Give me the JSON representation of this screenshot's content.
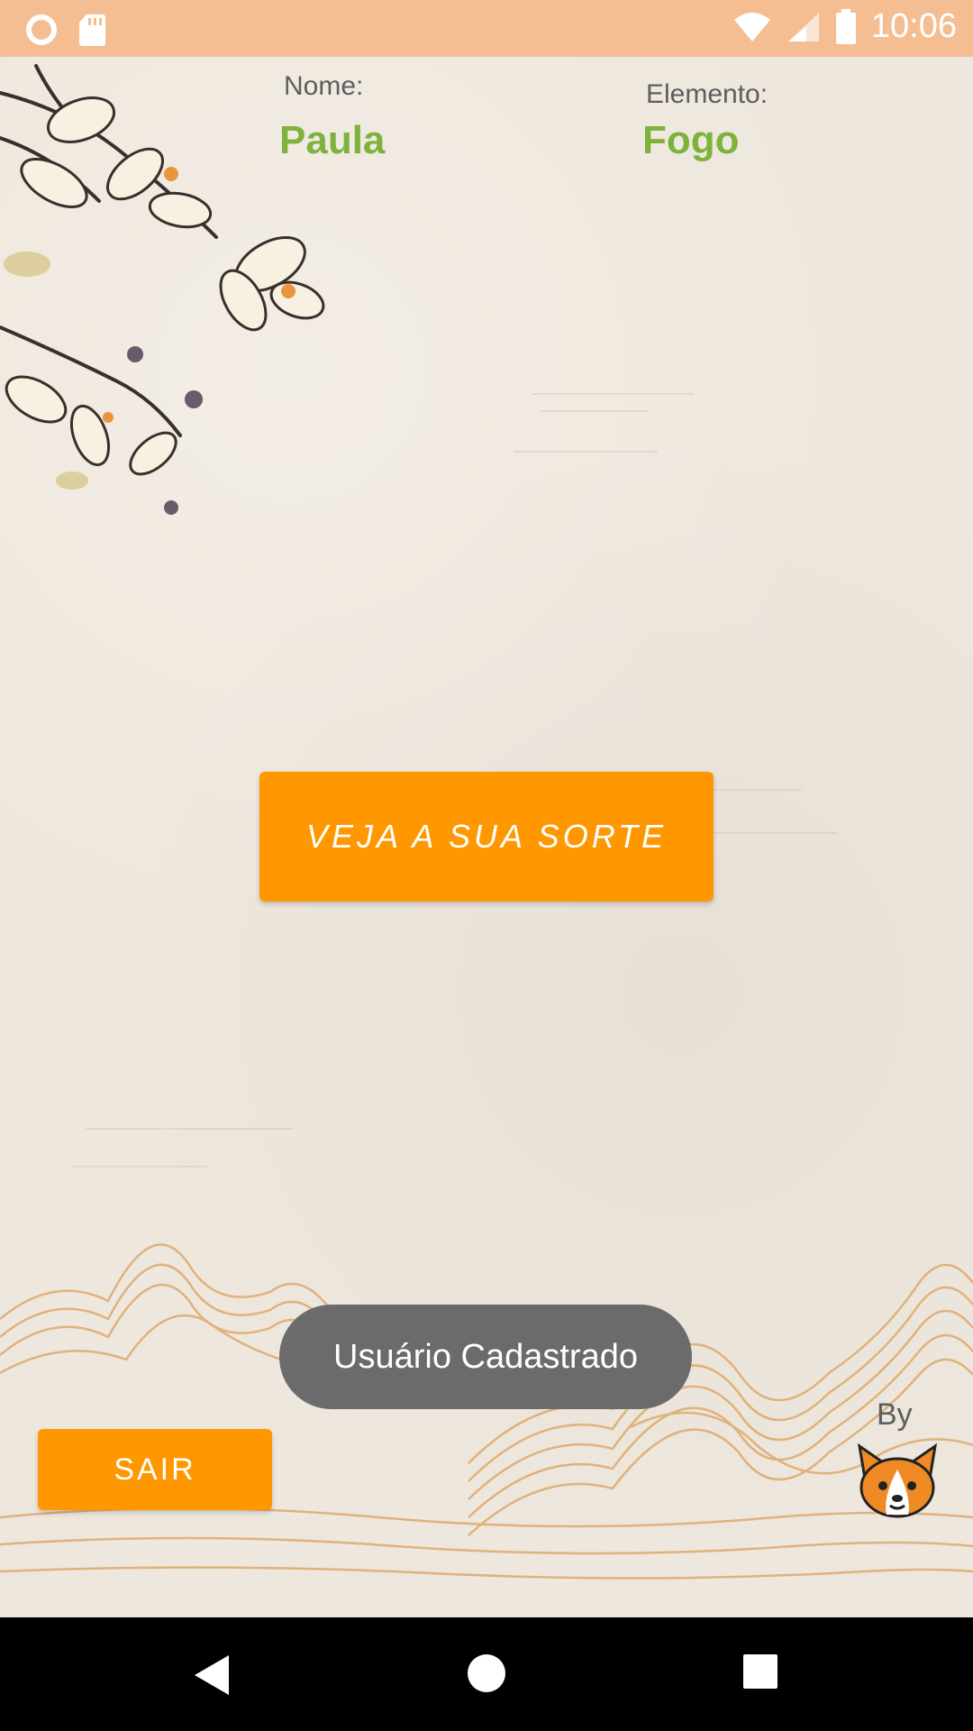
{
  "status_bar": {
    "time": "10:06",
    "icons": [
      "circle-icon",
      "sd-card-icon",
      "wifi-icon",
      "signal-icon",
      "battery-icon"
    ]
  },
  "profile": {
    "name_label": "Nome:",
    "name_value": "Paula",
    "element_label": "Elemento:",
    "element_value": "Fogo"
  },
  "actions": {
    "fortune_button": "VEJA A SUA SORTE",
    "exit_button": "SAIR"
  },
  "toast": {
    "message": "Usuário Cadastrado"
  },
  "footer": {
    "by_label": "By",
    "logo": "corgi-logo-icon"
  },
  "nav": {
    "icons": [
      "back-icon",
      "home-icon",
      "recents-icon"
    ]
  },
  "colors": {
    "accent": "#FF9800",
    "value_green": "#7DB33C",
    "status_bar": "#F4BE92",
    "background": "#EEE7DD",
    "toast": "#6B6B6B"
  }
}
